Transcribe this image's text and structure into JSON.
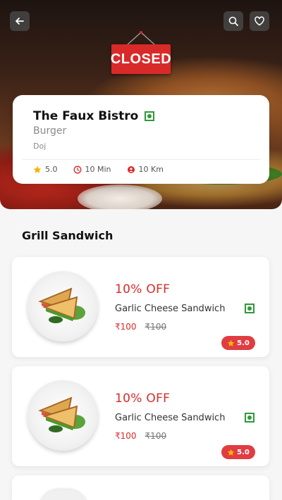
{
  "header": {
    "back_icon": "arrow-left-icon",
    "search_icon": "search-icon",
    "favorite_icon": "heart-icon",
    "status_sign": "CLOSED"
  },
  "restaurant": {
    "name": "The Faux Bistro",
    "cuisine": "Burger",
    "area": "Doj",
    "rating": "5.0",
    "delivery_time": "10 Min",
    "distance": "10 Km"
  },
  "section": {
    "title": "Grill Sandwich"
  },
  "items": [
    {
      "discount": "10% OFF",
      "name": "Garlic Cheese Sandwich",
      "price": "₹100",
      "mrp": "₹100",
      "rating": "5.0"
    },
    {
      "discount": "10% OFF",
      "name": "Garlic Cheese Sandwich",
      "price": "₹100",
      "mrp": "₹100",
      "rating": "5.0"
    }
  ],
  "colors": {
    "accent": "#d92a2a",
    "veg": "#2e9a3a",
    "star": "#f5b400"
  }
}
